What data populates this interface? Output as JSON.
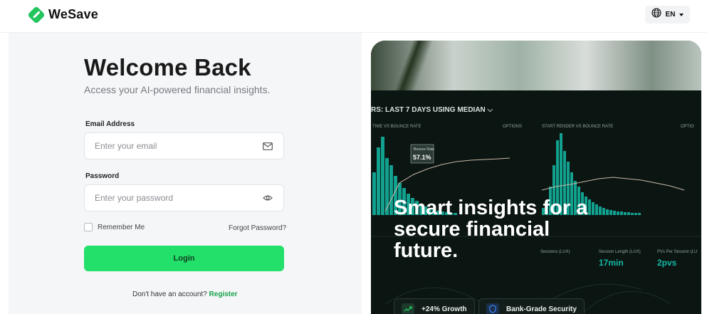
{
  "header": {
    "brand": "WeSave",
    "language": "EN"
  },
  "login": {
    "title": "Welcome Back",
    "subtitle": "Access your AI-powered financial insights.",
    "email_label": "Email Address",
    "email_placeholder": "Enter your email",
    "password_label": "Password",
    "password_placeholder": "Enter your password",
    "remember_label": "Remember Me",
    "forgot_label": "Forgot Password?",
    "login_label": "Login",
    "signup_prompt": "Don't have an account?",
    "signup_link": "Register"
  },
  "hero": {
    "dashboard_heading": "RS: LAST 7 DAYS USING MEDIAN",
    "left_panel_title": "TIME VS BOUNCE RATE",
    "left_panel_options": "OPTIONS",
    "right_panel_title": "START RENDER VS BOUNCE RATE",
    "right_panel_options": "OPTIO",
    "tooltip_label": "Bounce Rate",
    "tooltip_value": "57.1%",
    "stat_sessions": "Sessions (LUX)",
    "stat_session_length": "Session Length (LUX)",
    "stat_pvs": "PVs Per Session (LU",
    "stat_session_value": "17min",
    "stat_pvs_value": "2pvs",
    "headline": "Smart insights for a secure financial future.",
    "chips": [
      {
        "label": "+24% Growth",
        "icon": "trend-up-icon"
      },
      {
        "label": "Bank-Grade Security",
        "icon": "shield-icon"
      }
    ]
  },
  "colors": {
    "accent": "#22e06a",
    "brand": "#22c55e",
    "link": "#16a34a",
    "chart": "#14b8a6"
  }
}
